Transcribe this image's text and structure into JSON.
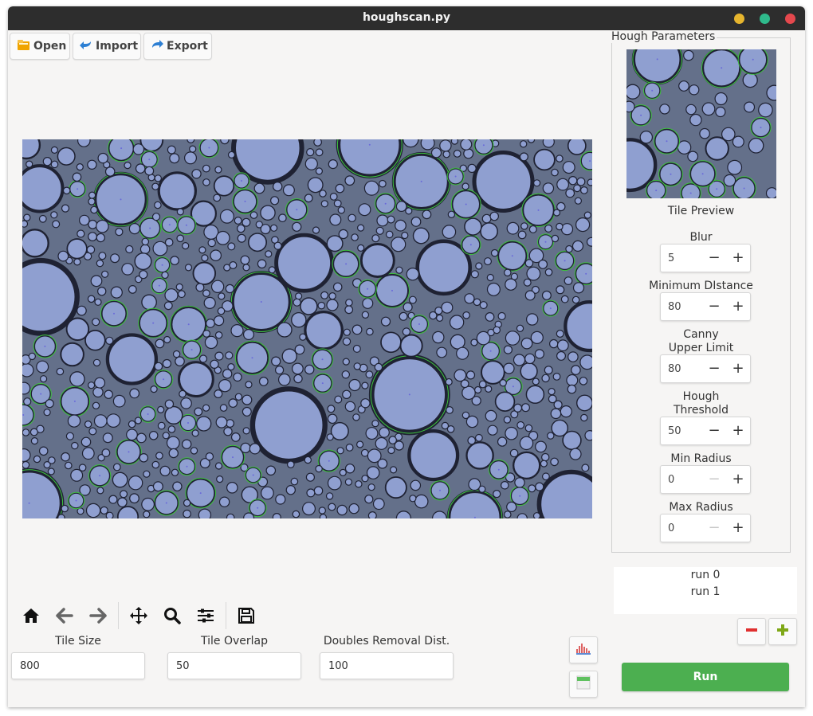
{
  "window": {
    "title": "houghscan.py",
    "controls": [
      {
        "name": "minimize",
        "color": "#e6b52e"
      },
      {
        "name": "maximize",
        "color": "#2fba8c"
      },
      {
        "name": "close",
        "color": "#e5484d"
      }
    ]
  },
  "top_toolbar": {
    "open_label": "Open",
    "import_label": "Import",
    "export_label": "Export"
  },
  "image_panel": {
    "image": "bubble-detection-image",
    "circle_color": "#3ec43e",
    "center_color": "#6a6ad8"
  },
  "plot_toolbar": {
    "icons": [
      "home-icon",
      "back-arrow-icon",
      "forward-arrow-icon",
      "pan-icon",
      "zoom-icon",
      "configure-subplots-icon",
      "save-icon"
    ]
  },
  "tile_settings": {
    "tile_size": {
      "label": "Tile Size",
      "value": "800"
    },
    "tile_overlap": {
      "label": "Tile Overlap",
      "value": "50"
    },
    "doubles_removal": {
      "label": "Doubles Removal Dist.",
      "value": "100"
    }
  },
  "hough_parameters": {
    "title": "Hough Parameters",
    "preview_label": "Tile Preview",
    "params": [
      {
        "label": "Blur",
        "value": "5"
      },
      {
        "label": "Minimum DIstance",
        "value": "80"
      },
      {
        "label": "Canny\nUpper Limit",
        "value": "80"
      },
      {
        "label": "Hough\nThreshold",
        "value": "50"
      },
      {
        "label": "Min Radius",
        "value": "0"
      },
      {
        "label": "Max Radius",
        "value": "0"
      }
    ],
    "minus_glyph": "−",
    "plus_glyph": "+"
  },
  "runs": {
    "items": [
      "run 0",
      "run 1"
    ],
    "remove_color": "#e03030",
    "add_color": "#7fa818"
  },
  "run_button": {
    "label": "Run",
    "color": "#4caf50"
  }
}
